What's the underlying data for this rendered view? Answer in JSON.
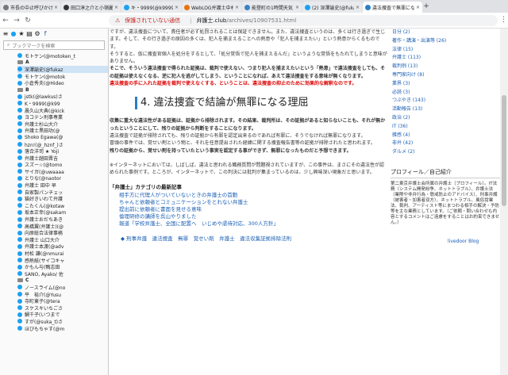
{
  "tabs": [
    {
      "label": "市長の中止呼びかけ",
      "color": "#777"
    },
    {
      "label": "田口淳之介と小嶺麗奈",
      "color": "#333"
    },
    {
      "label": "キ・9999(@k99997)",
      "color": "#1da1f2"
    },
    {
      "label": "WebLOG弁護士中村正",
      "color": "#e8710a"
    },
    {
      "label": "能登町の1時間天気",
      "color": "#3b82c4"
    },
    {
      "label": "(2) 深澤諭史(@fukaz",
      "color": "#1da1f2"
    },
    {
      "label": "違法捜査で無罪になる",
      "color": "#2a7fc4"
    }
  ],
  "address": {
    "warning": "保護されていない通信",
    "host": "弁護士.club",
    "path": "/archives/10907531.html"
  },
  "sidebar": {
    "search_placeholder": "ブックマークを検索",
    "items": [
      {
        "t": "モトケン(@motoken_t",
        "k": "i"
      },
      {
        "t": "A",
        "k": "f"
      },
      {
        "t": "深澤諭史(@fukaz",
        "k": "i",
        "s": 1
      },
      {
        "t": "モトケン(@motok",
        "k": "i"
      },
      {
        "t": "小倉秀夫(@Hideo",
        "k": "i"
      },
      {
        "t": "B",
        "k": "f"
      },
      {
        "t": "jstk(@lawkus)さ",
        "k": "i"
      },
      {
        "t": "K・9999(@k99",
        "k": "i"
      },
      {
        "t": "晨久山大典(@kick",
        "k": "i"
      },
      {
        "t": "ヨコテン刑事専業",
        "k": "i"
      },
      {
        "t": "弁護士杉山大介",
        "k": "i"
      },
      {
        "t": "弁護士黒田功(@",
        "k": "i"
      },
      {
        "t": "Shoko Egawa(@",
        "k": "i"
      },
      {
        "t": "hzn!(@_hznf_)さ",
        "k": "i"
      },
      {
        "t": "落合洋司 ★ Yoji",
        "k": "i"
      },
      {
        "t": "弁護士趙田晋吉",
        "k": "i"
      },
      {
        "t": "スズー☆(@tomo",
        "k": "i"
      },
      {
        "t": "サイガ(@uwaaaa",
        "k": "i"
      },
      {
        "t": "とりな(@naotor",
        "k": "i"
      },
      {
        "t": "弁護士 田中 早",
        "k": "i"
      },
      {
        "t": "自家製パンチェッ",
        "k": "i"
      },
      {
        "t": "猫好きいわて弁護",
        "k": "i"
      },
      {
        "t": "こたくん(@kotaw",
        "k": "i"
      },
      {
        "t": "坂本正幸(@sakam",
        "k": "i"
      },
      {
        "t": "弁護士おだちあき",
        "k": "i"
      },
      {
        "t": "高橋翼(弁護士)(@",
        "k": "i"
      },
      {
        "t": "向原総合法律事務",
        "k": "i"
      },
      {
        "t": "弁護士 山口大介",
        "k": "i"
      },
      {
        "t": "弁護士本渡(@adv",
        "k": "i"
      },
      {
        "t": "村松 謙(@nmurai",
        "k": "i"
      },
      {
        "t": "感熱紙(サイコキャ",
        "k": "i"
      },
      {
        "t": "かもん与(鴨志田",
        "k": "i"
      },
      {
        "t": "SANO, Ayako/ 佐",
        "k": "i"
      },
      {
        "t": "C",
        "k": "f"
      },
      {
        "t": "ノースライム(@no",
        "k": "i"
      },
      {
        "t": "平　裕介(@Yusu",
        "k": "i"
      },
      {
        "t": "寺町東子(@tera",
        "k": "i"
      },
      {
        "t": "スケスキいちごさ",
        "k": "i"
      },
      {
        "t": "鯛千子(いつまで",
        "k": "i"
      },
      {
        "t": "すが(@suka_t)さ",
        "k": "i"
      },
      {
        "t": "ほびもちゃす(@m",
        "k": "i"
      }
    ]
  },
  "article": {
    "intro": [
      {
        "t": "ですが、違法捜査について、責任者が必ず処罰されることは保証できません。また、違法捜査というのは、多くは行き過ぎで生じます。そして、その行き過ぎの原因の多くは、犯人を捕まえることへの熱意や「犯人を捕まえたい」という熱意からくるものです。",
        "c": ""
      },
      {
        "t": "そうすると、仮に捜査官個人を処分をするとして、「処分覚悟で犯人を捕まえるんだ」というような覚悟をもたれてしまうと意味がありません。",
        "c": ""
      },
      {
        "t": "そこで、そういう違法捜査で得られた証拠は、裁判で使えない、つまり犯人を捕まえたいという「熱意」で違法捜査をしても、その証拠は使えなくなる、逆に犯人を逃がしてしまう、ということになれば、あえて違法捜査をする意味が無くなります。",
        "c": "b"
      },
      {
        "t": "違法捜査の手に入れた証拠を裁判で使えなくする、ということは、違法捜査の抑止のために効果的な解釈なのです。",
        "c": "red"
      }
    ],
    "heading": "4. 違法捜査で結論が無罪になる理屈",
    "body": [
      {
        "t": "収集に重大な違法性がある証拠は、証拠から排除されます。その結果、裁判所は、その証拠があると知らないことも、それが無かったということにして、残りの証拠から判断をすることになります。",
        "c": "b"
      },
      {
        "t": "違法捜査で証拠が排除されても、残りの証拠から有罪を認定出来るのであれば有罪に、そうでなければ無罪になります。",
        "c": ""
      },
      {
        "t": "冒頭の事件では、覚せい剤という物と、それを任意提出された経緯に関する捜査報告書等の証拠が排除されたと思われます。",
        "c": ""
      },
      {
        "t": "残りの証拠から、覚せい剤を持っていたという事実を認定する事ができず、無罪になったものだと予想できます。",
        "c": "b"
      },
      {
        "t": "",
        "c": ""
      },
      {
        "t": "※インターネットにおいては、しばしば、違法と思われる職務質問が問題視されていますが、この事件は、まさにその違法性が認められた事例です。ところが、インターネットで、この判決には批判が集まっているのは、少し興味深い現象だと思います。",
        "c": ""
      }
    ],
    "category": {
      "title": "「弁護士」カテゴリの最新記事",
      "links": [
        "相手方に代理人がついていないときの弁護士の首動",
        "ちゃんと依頼者とコミュニケーションをとれない弁護士",
        "提出前に依頼者に書面を見せる意味",
        "倫理研修の講師を呉山やりました",
        "報道「学校弁護士、全国に配置へ　いじめや虐待対応、300人方針」"
      ]
    },
    "tags": "刑事弁護　違法捜査　無罪　覚せい剤　弁護士　違法収集証拠排除法則"
  },
  "right": {
    "links": [
      "日分 (2)",
      "著作・講演・出演等 (26)",
      "法律 (15)",
      "弁護士 (113)",
      "裁判例 (13)",
      "専門家向け (8)",
      "業界 (3)",
      "必読 (3)",
      "つぶやき (143)",
      "活動報告 (13)",
      "政治 (2)",
      "IT (36)",
      "雑感 (4)",
      "非弁 (42)",
      "ダルメ (2)"
    ],
    "profile_title": "プロフィール／自己紹介",
    "profile_text": "第二東京弁護士会所属の弁護士（プロフィール）。IT法務（システム開発紛争、ネットトラブル）、弁護士法（業際や非弁行為・懲戒防止のアドバイス）、刑事弁護（被害者・加害者双方）、ネットトラブル、風俗営業法、裁判、アーティスト等にまつわる相手の解決・予防等を主な業務としています。（ご依頼・問い合わせも内容とするコメントはご遠慮をすることはお約束できません。）",
    "brand": "livedoor Blog"
  }
}
